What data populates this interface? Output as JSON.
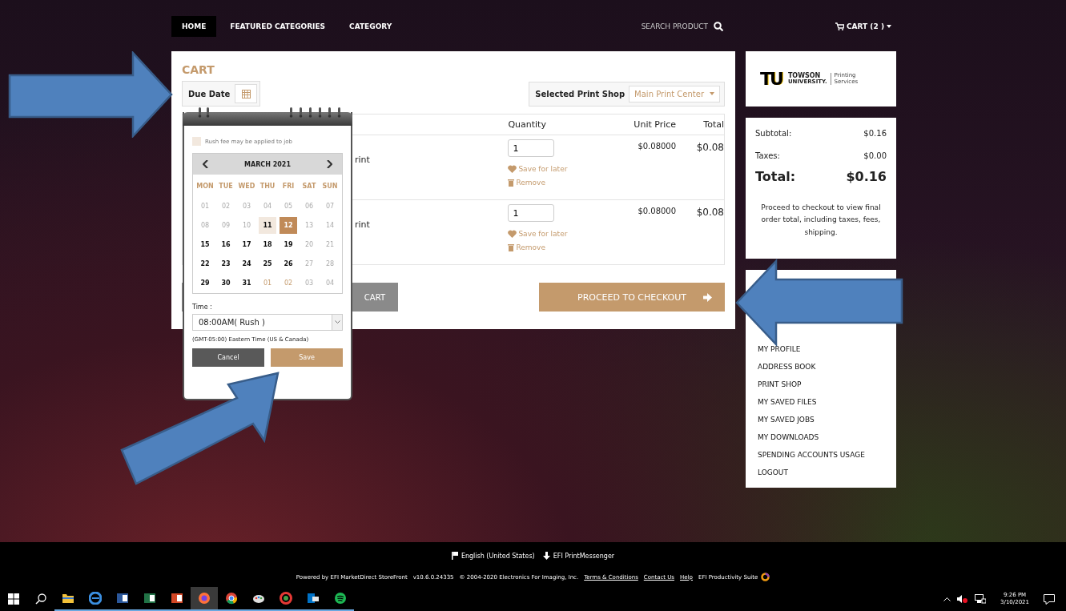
{
  "nav": {
    "items": [
      {
        "label": "HOME",
        "selected": true
      },
      {
        "label": "FEATURED CATEGORIES",
        "selected": false
      },
      {
        "label": "CATEGORY",
        "selected": false
      }
    ],
    "search_label": "SEARCH PRODUCT",
    "cart": "CART (2 )"
  },
  "cart": {
    "title": "CART",
    "due_date_label": "Due Date",
    "print_shop_label": "Selected Print Shop",
    "print_shop_value": "Main Print Center",
    "columns": [
      "Quantity",
      "Unit Price",
      "Total"
    ],
    "rows": [
      {
        "product": "rint",
        "quantity": "1",
        "unit_price": "$0.08000",
        "total": "$0.08",
        "save": "Save for later",
        "remove": "Remove"
      },
      {
        "product": "rint",
        "quantity": "1",
        "unit_price": "$0.08000",
        "total": "$0.08",
        "save": "Save for later",
        "remove": "Remove"
      }
    ],
    "continue_button": "CART",
    "checkout_button": "PROCEED TO CHECKOUT"
  },
  "date_picker": {
    "legend": "Rush fee may be applied to job",
    "month": "MARCH 2021",
    "weekdays": [
      "MON",
      "TUE",
      "WED",
      "THU",
      "FRI",
      "SAT",
      "SUN"
    ],
    "weeks": [
      [
        {
          "label": "01",
          "kind": "unavailable",
          "selected": false
        },
        {
          "label": "02",
          "kind": "unavailable",
          "selected": false
        },
        {
          "label": "03",
          "kind": "unavailable",
          "selected": false
        },
        {
          "label": "04",
          "kind": "unavailable",
          "selected": false
        },
        {
          "label": "05",
          "kind": "unavailable",
          "selected": false
        },
        {
          "label": "06",
          "kind": "unavailable",
          "selected": false
        },
        {
          "label": "07",
          "kind": "unavailable",
          "selected": false
        }
      ],
      [
        {
          "label": "08",
          "kind": "unavailable",
          "selected": false
        },
        {
          "label": "09",
          "kind": "unavailable",
          "selected": false
        },
        {
          "label": "10",
          "kind": "unavailable",
          "selected": false
        },
        {
          "label": "11",
          "kind": "rush",
          "selected": false
        },
        {
          "label": "12",
          "kind": "rush",
          "selected": true
        },
        {
          "label": "13",
          "kind": "unavailable",
          "selected": false
        },
        {
          "label": "14",
          "kind": "unavailable",
          "selected": false
        }
      ],
      [
        {
          "label": "15",
          "kind": "available",
          "selected": false
        },
        {
          "label": "16",
          "kind": "available",
          "selected": false
        },
        {
          "label": "17",
          "kind": "available",
          "selected": false
        },
        {
          "label": "18",
          "kind": "available",
          "selected": false
        },
        {
          "label": "19",
          "kind": "available",
          "selected": false
        },
        {
          "label": "20",
          "kind": "unavailable",
          "selected": false
        },
        {
          "label": "21",
          "kind": "unavailable",
          "selected": false
        }
      ],
      [
        {
          "label": "22",
          "kind": "available",
          "selected": false
        },
        {
          "label": "23",
          "kind": "available",
          "selected": false
        },
        {
          "label": "24",
          "kind": "available",
          "selected": false
        },
        {
          "label": "25",
          "kind": "available",
          "selected": false
        },
        {
          "label": "26",
          "kind": "available",
          "selected": false
        },
        {
          "label": "27",
          "kind": "unavailable",
          "selected": false
        },
        {
          "label": "28",
          "kind": "unavailable",
          "selected": false
        }
      ],
      [
        {
          "label": "29",
          "kind": "available",
          "selected": false
        },
        {
          "label": "30",
          "kind": "available",
          "selected": false
        },
        {
          "label": "31",
          "kind": "available",
          "selected": false
        },
        {
          "label": "01",
          "kind": "next_month",
          "selected": false
        },
        {
          "label": "02",
          "kind": "next_month",
          "selected": false
        },
        {
          "label": "03",
          "kind": "unavailable",
          "selected": false
        },
        {
          "label": "04",
          "kind": "unavailable",
          "selected": false
        }
      ]
    ],
    "time_label": "Time :",
    "time_value": "08:00AM( Rush )",
    "timezone": "(GMT-05:00) Eastern Time (US & Canada)",
    "cancel": "Cancel",
    "save": "Save"
  },
  "logo": {
    "mark": "TU",
    "name_1": "TOWSON",
    "name_2": "UNIVERSITY.",
    "dept_1": "Printing",
    "dept_2": "Services"
  },
  "summary": {
    "lines": [
      {
        "label": "Subtotal:",
        "value": "$0.16",
        "kind": "normal"
      },
      {
        "label": "Taxes:",
        "value": "$0.00",
        "kind": "normal"
      },
      {
        "label": "Total:",
        "value": "$0.16",
        "kind": "grand"
      }
    ],
    "note": "Proceed to checkout to view final order total, including taxes, fees, shipping."
  },
  "account_menu": [
    "MY PROFILE",
    "ADDRESS BOOK",
    "PRINT SHOP",
    "MY SAVED FILES",
    "MY SAVED JOBS",
    "MY DOWNLOADS",
    "SPENDING ACCOUNTS USAGE",
    "LOGOUT"
  ],
  "annotations": [
    {
      "kind": "right"
    },
    {
      "kind": "left"
    },
    {
      "kind": "up_right"
    }
  ],
  "footer": {
    "language": "English (United States)",
    "messenger": "EFI PrintMessenger",
    "powered": "Powered by EFI MarketDirect StoreFront",
    "version": "v10.6.0.24335",
    "copyright": "© 2004-2020 Electronics For Imaging, Inc.",
    "links": [
      "Terms & Conditions",
      "Contact Us",
      "Help"
    ],
    "suite": "EFI Productivity Suite"
  },
  "taskbar": {
    "apps": [
      {
        "kind": "explorer",
        "selected": false
      },
      {
        "kind": "edge",
        "selected": false
      },
      {
        "kind": "word",
        "selected": false
      },
      {
        "kind": "excel",
        "selected": false
      },
      {
        "kind": "powerpoint",
        "selected": false
      },
      {
        "kind": "firefox",
        "selected": true
      },
      {
        "kind": "chrome",
        "selected": false
      },
      {
        "kind": "paint",
        "selected": false
      },
      {
        "kind": "viewer",
        "selected": false
      },
      {
        "kind": "outlook",
        "selected": false
      },
      {
        "kind": "spotify",
        "selected": false
      }
    ],
    "time": "9:26 PM",
    "date": "3/10/2021"
  }
}
